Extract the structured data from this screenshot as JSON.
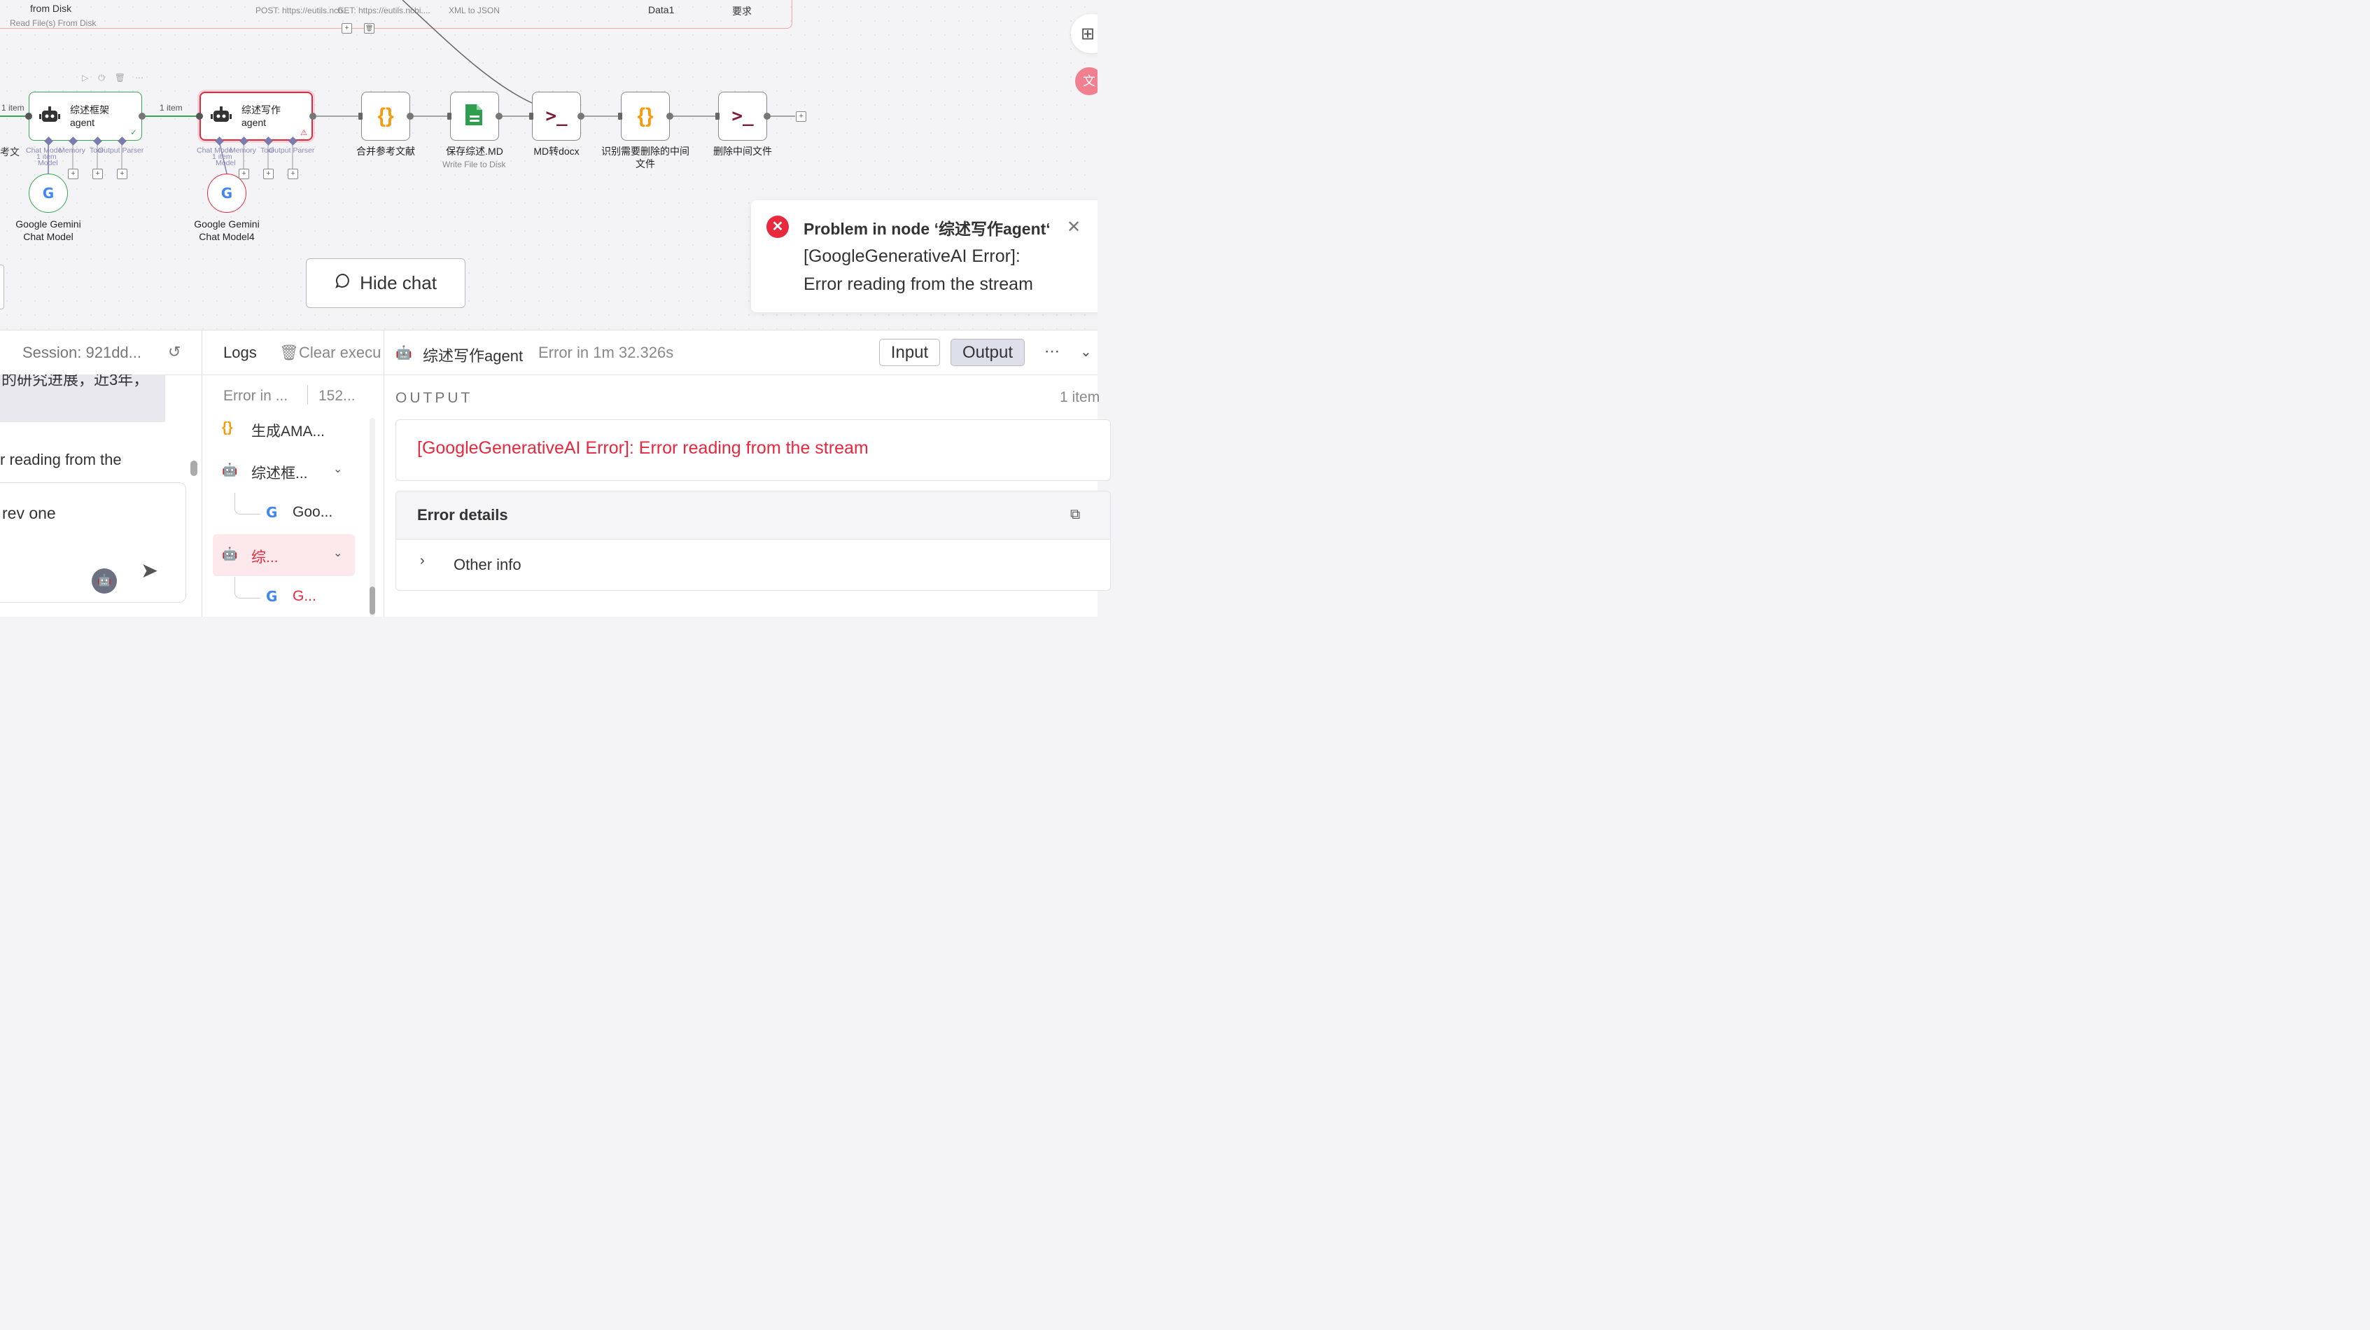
{
  "canvas": {
    "top_nodes": [
      {
        "label": "from Disk",
        "sublabel": "Read File(s) From Disk"
      },
      {
        "label": "",
        "sublabel": "POST: https://eutils.ncb..."
      },
      {
        "label": "",
        "sublabel": "GET: https://eutils.ncbi...."
      },
      {
        "label": "",
        "sublabel": "XML to JSON"
      },
      {
        "label": "Data1",
        "sublabel": ""
      },
      {
        "label": "要求",
        "sublabel": ""
      }
    ],
    "edge_labels": {
      "left": "1 item",
      "middle": "1 item"
    },
    "partial_left_label": "考文",
    "agent1": {
      "line1": "综述框架",
      "line2": "agent",
      "sub": [
        "Chat Mode",
        "Memory",
        "Tool",
        "Output Parser"
      ],
      "sub_item": "1 item",
      "sub_model": "Model"
    },
    "agent2": {
      "line1": "综述写作",
      "line2": "agent",
      "sub": [
        "Chat Mode",
        "Memory",
        "Tool",
        "Output Parser"
      ],
      "sub_item": "1 item",
      "sub_model": "Model"
    },
    "gemini1": {
      "line1": "Google Gemini",
      "line2": "Chat Model"
    },
    "gemini2": {
      "line1": "Google Gemini",
      "line2": "Chat Model4"
    },
    "nodes": [
      {
        "label": "合并参考文献",
        "sublabel": "",
        "icon": "braces-icon"
      },
      {
        "label": "保存综述.MD",
        "sublabel": "Write File to Disk",
        "icon": "file-icon"
      },
      {
        "label": "MD转docx",
        "sublabel": "",
        "icon": "terminal-icon"
      },
      {
        "label": "识别需要删除的中间",
        "label2": "文件",
        "sublabel": "",
        "icon": "braces-icon"
      },
      {
        "label": "删除中间文件",
        "sublabel": "",
        "icon": "terminal-icon"
      }
    ]
  },
  "toast": {
    "title": "Problem in node ‘综述写作agent‘",
    "message_line1": "[GoogleGenerativeAI Error]:",
    "message_line2": "Error reading from the stream"
  },
  "hide_chat": {
    "label": "Hide chat"
  },
  "chat": {
    "session": "Session: 921dd...",
    "bubble_text": "的研究进展，近3年，",
    "error_text": "r reading from the",
    "input_text": "rev one"
  },
  "logs": {
    "title": "Logs",
    "clear": "Clear execu",
    "summary_status": "Error in ...",
    "summary_time": "152...",
    "items": [
      {
        "label": "生成AMA...",
        "icon": "braces-icon"
      },
      {
        "label": "综述框...",
        "icon": "robot-icon"
      },
      {
        "label": "Goo...",
        "icon": "google-icon"
      },
      {
        "label": "综...",
        "icon": "robot-icon"
      },
      {
        "label": "G...",
        "icon": "google-icon"
      }
    ]
  },
  "output": {
    "node_name": "综述写作agent",
    "status": "Error in 1m 32.326s",
    "input_btn": "Input",
    "output_btn": "Output",
    "section_title": "OUTPUT",
    "item_count": "1 item",
    "error_message": "[GoogleGenerativeAI Error]: Error reading from the stream",
    "details_title": "Error details",
    "other_info": "Other info"
  },
  "colors": {
    "error": "#e8283c",
    "success": "#34a853",
    "accent": "#ff6d5a"
  }
}
